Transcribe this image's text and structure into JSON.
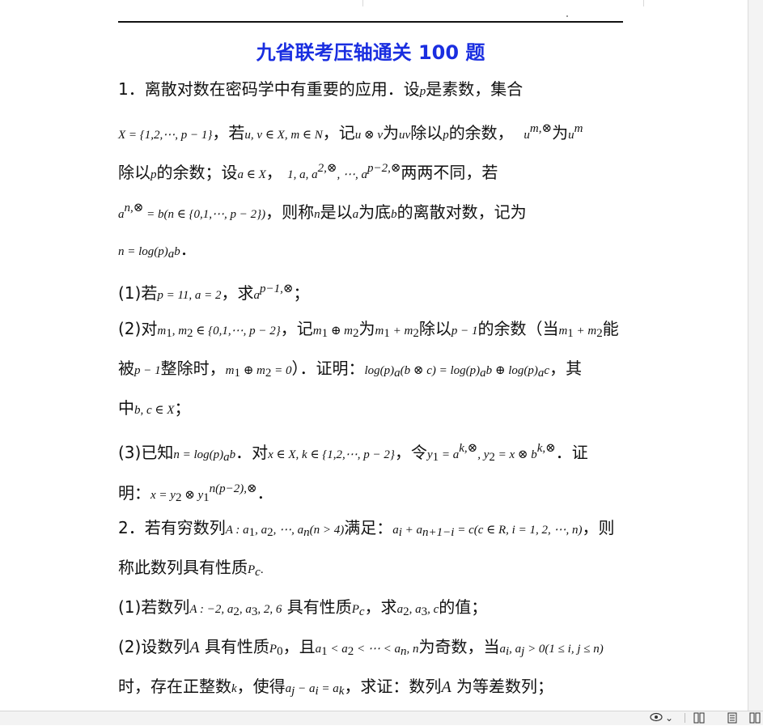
{
  "title": "九省联考压轴通关 100 题",
  "lines": [
    {
      "pre": "1．离散对数在密码学中有重要的应用．设",
      "m1": "p",
      "mid": "是素数，集合",
      "m2": "",
      "post": ""
    },
    {
      "m0": "X = {1,2,⋯, p − 1}",
      "t1": "，若",
      "m1": "u, v ∈ X, m ∈ N",
      "t2": "，记",
      "m2": "u ⊗ v",
      "t3": "为",
      "m3": "uv",
      "t4": "除以",
      "m4": "p",
      "t5": "的余数，",
      "m5": "u",
      "m5sup": "m,⊗",
      "t6": "为",
      "m6": "u",
      "m6sup": "m"
    },
    {
      "t1": "除以",
      "m1": "p",
      "t2": "的余数；设",
      "m2": "a ∈ X",
      "t3": "，",
      "m3": "1, a, a",
      "m3sup": "2,⊗",
      "m3b": ", ⋯, a",
      "m3bsup": "p−2,⊗",
      "t4": "两两不同，若"
    },
    {
      "m1": "a",
      "m1sup": "n,⊗",
      "m1b": " = b(n ∈ {0,1,⋯, p − 2})",
      "t1": "，则称",
      "m2": "n",
      "t2": "是以",
      "m3": "a",
      "t3": "为底",
      "m4": "b",
      "t4": "的离散对数，记为"
    },
    {
      "m1": "n = log(p)",
      "m1sub": "a",
      "m1b": "b",
      "t1": "．"
    },
    {
      "t0": "(1)若",
      "m1": "p = 11, a = 2",
      "t1": "，求",
      "m2": "a",
      "m2sup": "p−1,⊗",
      "t2": "；"
    },
    {
      "t0": "(2)对",
      "m1": "m",
      "m1sub": "1",
      "m1b": ", m",
      "m1bsub": "2",
      "m1c": " ∈ {0,1,⋯, p − 2}",
      "t1": "，记",
      "m2": "m",
      "m2sub": "1",
      "m2b": " ⊕ m",
      "m2bsub": "2",
      "t2": "为",
      "m3": "m",
      "m3sub": "1",
      "m3b": " + m",
      "m3bsub": "2",
      "t3": "除以",
      "m4": "p − 1",
      "t4": "的余数（当",
      "m5": "m",
      "m5sub": "1",
      "m5b": " + m",
      "m5bsub": "2",
      "t5": "能"
    },
    {
      "t0": "被",
      "m1": "p − 1",
      "t1": "整除时，",
      "m2": "m",
      "m2sub": "1",
      "m2b": " ⊕ m",
      "m2bsub": "2",
      "m2c": " = 0",
      "t2": "）．证明：",
      "m3": "log(p)",
      "m3sub": "a",
      "m3b": "(b ⊗ c) = log(p)",
      "m3bsub": "a",
      "m3c": "b ⊕ log(p)",
      "m3csub": "a",
      "m3d": "c",
      "t3": "，其"
    },
    {
      "t0": "中",
      "m1": "b, c ∈ X",
      "t1": "；"
    },
    {
      "t0": "(3)已知",
      "m1": "n = log(p)",
      "m1sub": "a",
      "m1b": "b",
      "t1": "．对",
      "m2": "x ∈ X, k ∈ {1,2,⋯, p − 2}",
      "t2": "，令",
      "m3": "y",
      "m3sub": "1",
      "m3b": " = a",
      "m3bsup": "k,⊗",
      "m3c": ", y",
      "m3csub": "2",
      "m3d": " = x ⊗ b",
      "m3dsup": "k,⊗",
      "t3": "．证"
    },
    {
      "t0": "明：",
      "m1": "x = y",
      "m1sub": "2",
      "m1b": " ⊗ y",
      "m1bsub": "1",
      "m1bsup": "n(p−2),⊗",
      "t1": "．"
    },
    {
      "t0": "2．若有穷数列",
      "m1": "A : a",
      "m1sub": "1",
      "m1b": ", a",
      "m1bsub": "2",
      "m1c": ", ⋯, a",
      "m1csub": "n",
      "m1d": "(n > 4)",
      "t1": "满足：",
      "m2": "a",
      "m2sub": "i",
      "m2b": " + a",
      "m2bsub": "n+1−i",
      "m2c": " = c(c ∈ R, i = 1, 2, ⋯, n)",
      "t2": "，则"
    },
    {
      "t0": "称此数列具有性质",
      "m1": "P",
      "m1sub": "c",
      "t1": "."
    },
    {
      "t0": "(1)若数列",
      "m1": "A : −2, a",
      "m1sub": "2",
      "m1b": ", a",
      "m1bsub": "3",
      "m1c": ", 2, 6",
      "t1": " 具有性质",
      "m2": "P",
      "m2sub": "c",
      "t2": "，求",
      "m3": "a",
      "m3sub": "2",
      "m3b": ", a",
      "m3bsub": "3",
      "m3c": ", c",
      "t3": "的值；"
    },
    {
      "t0": "(2)设数列",
      "m1": "A",
      "t1": " 具有性质",
      "m2": "P",
      "m2sub": "0",
      "t2": "，且",
      "m3": "a",
      "m3sub": "1",
      "m3b": " < a",
      "m3bsub": "2",
      "m3c": " < ⋯ < a",
      "m3csub": "n",
      "m3d": ", n",
      "t3": "为奇数，当",
      "m4": "a",
      "m4sub": "i",
      "m4b": ", a",
      "m4bsub": "j",
      "m4c": " > 0(1 ≤ i, j ≤ n)"
    },
    {
      "t0": "时，存在正整数",
      "m1": "k",
      "t1": "，使得",
      "m2": "a",
      "m2sub": "j",
      "m2b": " − a",
      "m2bsub": "i",
      "m2c": " = a",
      "m2csub": "k",
      "t2": "，求证：数列",
      "m3": "A",
      "t3": " 为等差数列；"
    }
  ],
  "statusbar": {
    "eye_icon": "eye-icon",
    "dropdown": "⌄",
    "layout_icon": "reading-layout-icon",
    "page_icon": "page-view-icon",
    "split_icon": "split-view-icon"
  }
}
